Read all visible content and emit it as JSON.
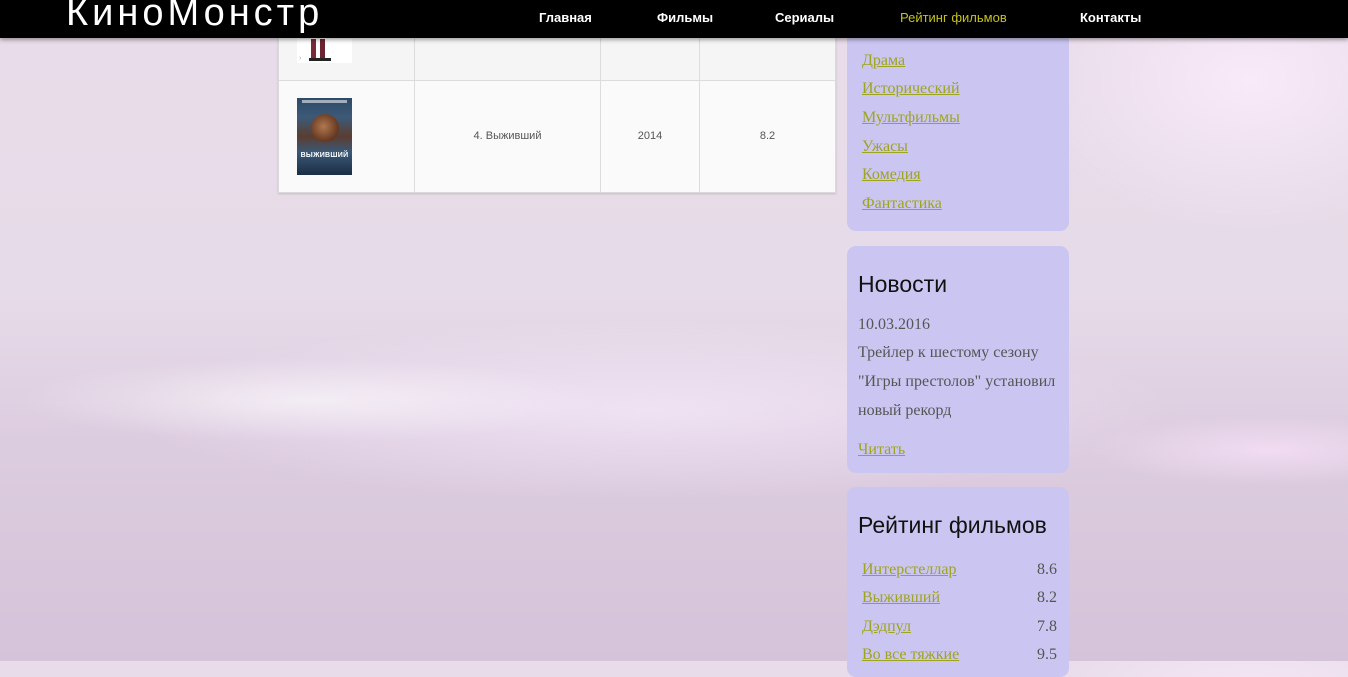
{
  "header": {
    "logo": "КиноМонстр",
    "nav": [
      {
        "label": "Главная",
        "active": false
      },
      {
        "label": "Фильмы",
        "active": false
      },
      {
        "label": "Сериалы",
        "active": false
      },
      {
        "label": "Рейтинг фильмов",
        "active": true
      },
      {
        "label": "Контакты",
        "active": false
      }
    ]
  },
  "table": {
    "rows": [
      {
        "title": "",
        "year": "",
        "rating": "",
        "poster": "poster-deadpool"
      },
      {
        "title": "4. Выживший",
        "year": "2014",
        "rating": "8.2",
        "poster": "poster-revenant",
        "poster_title": "ВЫЖИВШИЙ"
      }
    ]
  },
  "genres": {
    "items": [
      "Драма",
      "Исторический",
      "Мультфильмы",
      "Ужасы",
      "Комедия",
      "Фантастика"
    ]
  },
  "news": {
    "heading": "Новости",
    "date": "10.03.2016",
    "text": "Трейлер к шестому сезону \"Игры престолов\" установил новый рекорд",
    "read_label": "Читать"
  },
  "ratings": {
    "heading": "Рейтинг фильмов",
    "items": [
      {
        "title": "Интерстеллар",
        "value": "8.6"
      },
      {
        "title": "Выживший",
        "value": "8.2"
      },
      {
        "title": "Дэдпул",
        "value": "7.8"
      },
      {
        "title": "Во все тяжкие",
        "value": "9.5"
      }
    ]
  },
  "colors": {
    "link": "#9ea41d",
    "active_nav": "#c6c21c",
    "panel": "#cbc6f1",
    "topbar": "#000000"
  }
}
